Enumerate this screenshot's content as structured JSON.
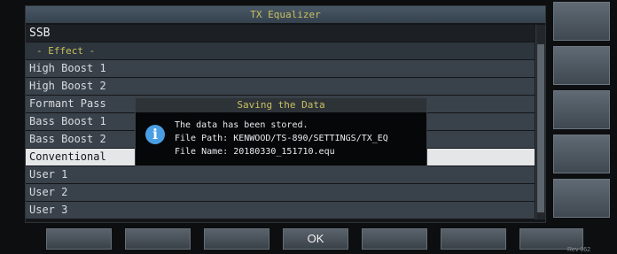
{
  "window": {
    "title": "TX Equalizer"
  },
  "list": {
    "header": "SSB",
    "section": "- Effect -",
    "items": [
      "High Boost 1",
      "High Boost 2",
      "Formant Pass",
      "Bass Boost 1",
      "Bass Boost 2",
      "Conventional",
      "User 1",
      "User 2",
      "User 3"
    ],
    "selected_item": "Conventional"
  },
  "dialog": {
    "title": "Saving the Data",
    "icon": "info-icon",
    "line1": "The data has been stored.",
    "line2": "File Path: KENWOOD/TS-890/SETTINGS/TX_EQ",
    "line3": "File Name: 20180330_151710.equ"
  },
  "buttons": {
    "ok_label": "OK"
  },
  "status": {
    "revision": "Rev 062"
  },
  "colors": {
    "title_text": "#c8c060",
    "selected_row": "#e4e6e8",
    "row_bg": "#39414a",
    "info_icon": "#4a9ee4"
  }
}
